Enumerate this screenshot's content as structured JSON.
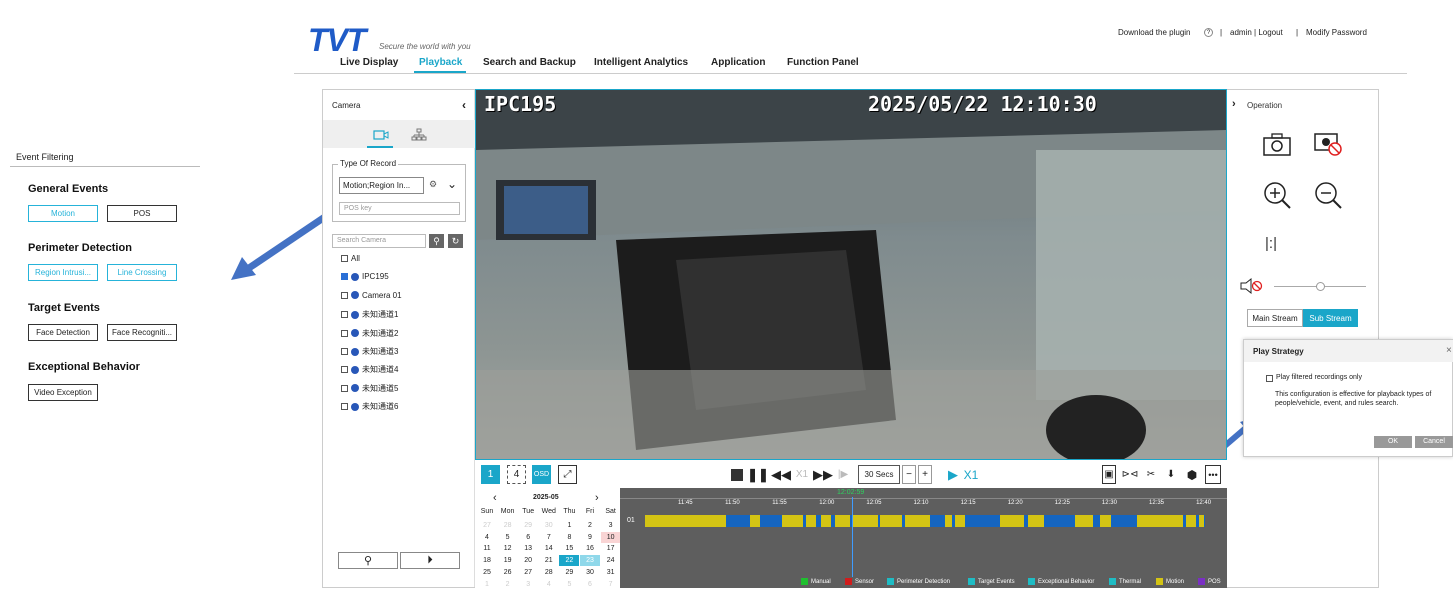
{
  "event_filtering": {
    "title": "Event Filtering",
    "groups": [
      {
        "title": "General Events",
        "buttons": [
          "Motion",
          "POS"
        ]
      },
      {
        "title": "Perimeter Detection",
        "buttons": [
          "Region Intrusi...",
          "Line Crossing"
        ]
      },
      {
        "title": "Target Events",
        "buttons": [
          "Face Detection",
          "Face Recogniti..."
        ]
      },
      {
        "title": "Exceptional Behavior",
        "buttons": [
          "Video Exception"
        ]
      }
    ]
  },
  "header": {
    "logo": "TVT",
    "slogan": "Secure the world with you",
    "nav": [
      "Live Display",
      "Playback",
      "Search and Backup",
      "Intelligent Analytics",
      "Application",
      "Function Panel"
    ],
    "download_plugin": "Download the plugin",
    "user": "admin | Logout",
    "modify_password": "Modify Password"
  },
  "camera_panel": {
    "title": "Camera",
    "type_of_record_label": "Type Of Record",
    "type_of_record_value": "Motion;Region In...",
    "pos_placeholder": "POS key",
    "search_placeholder": "Search Camera",
    "cameras": [
      {
        "name": "All",
        "checked": false,
        "globe": false
      },
      {
        "name": "IPC195",
        "checked": true,
        "globe": true
      },
      {
        "name": "Camera 01",
        "checked": false,
        "globe": true
      },
      {
        "name": "未知通道1",
        "checked": false,
        "globe": true
      },
      {
        "name": "未知通道2",
        "checked": false,
        "globe": true
      },
      {
        "name": "未知通道3",
        "checked": false,
        "globe": true
      },
      {
        "name": "未知通道4",
        "checked": false,
        "globe": true
      },
      {
        "name": "未知通道5",
        "checked": false,
        "globe": true
      },
      {
        "name": "未知通道6",
        "checked": false,
        "globe": true
      }
    ]
  },
  "video": {
    "camera_name": "IPC195",
    "datetime": "2025/05/22  12:10:30"
  },
  "controls": {
    "layout_1": "1",
    "layout_4": "4",
    "osd": "OSD",
    "speed": "X1",
    "interval": "30 Secs",
    "play_speed": "X1"
  },
  "operation": {
    "title": "Operation",
    "main_stream": "Main Stream",
    "sub_stream": "Sub Stream"
  },
  "play_strategy": {
    "title": "Play Strategy",
    "checkbox_label": "Play filtered recordings only",
    "note": "This configuration is effective for playback types of people/vehicle, event, and rules search.",
    "ok": "OK",
    "cancel": "Cancel"
  },
  "calendar": {
    "month": "2025-05",
    "weekdays": [
      "Sun",
      "Mon",
      "Tue",
      "Wed",
      "Thu",
      "Fri",
      "Sat"
    ],
    "rows": [
      [
        "27",
        "28",
        "29",
        "30",
        "1",
        "2",
        "3"
      ],
      [
        "4",
        "5",
        "6",
        "7",
        "8",
        "9",
        "10"
      ],
      [
        "11",
        "12",
        "13",
        "14",
        "15",
        "16",
        "17"
      ],
      [
        "18",
        "19",
        "20",
        "21",
        "22",
        "23",
        "24"
      ],
      [
        "25",
        "26",
        "27",
        "28",
        "29",
        "30",
        "31"
      ],
      [
        "1",
        "2",
        "3",
        "4",
        "5",
        "6",
        "7"
      ]
    ]
  },
  "timeline": {
    "current_time": "12:02:59",
    "channel": "01",
    "ticks": [
      "11:45",
      "11:50",
      "11:55",
      "12:00",
      "12:05",
      "12:10",
      "12:15",
      "12:20",
      "12:25",
      "12:30",
      "12:35",
      "12:40"
    ],
    "legend": [
      {
        "label": "Manual",
        "color": "#1fbf2f"
      },
      {
        "label": "Sensor",
        "color": "#d01c1c"
      },
      {
        "label": "Perimeter Detection",
        "color": "#1fbcc4"
      },
      {
        "label": "Target Events",
        "color": "#1fbcc4"
      },
      {
        "label": "Exceptional Behavior",
        "color": "#1fbcc4"
      },
      {
        "label": "Thermal",
        "color": "#1fbcc4"
      },
      {
        "label": "Motion",
        "color": "#d4c414"
      },
      {
        "label": "POS",
        "color": "#7a2fc4"
      }
    ]
  },
  "colors": {
    "accent": "#1aa6c9",
    "brand": "#1f5bc7",
    "motion": "#d4c414",
    "region": "#1565c0"
  }
}
